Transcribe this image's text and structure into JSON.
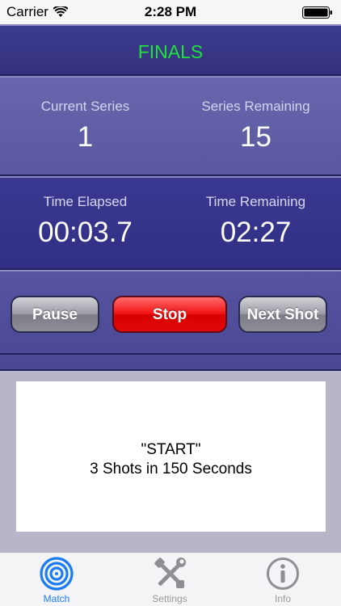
{
  "status_bar": {
    "carrier": "Carrier",
    "time": "2:28 PM"
  },
  "header": {
    "title": "FINALS",
    "title_color": "#1fe33a"
  },
  "series": {
    "current": {
      "label": "Current Series",
      "value": "1"
    },
    "remaining": {
      "label": "Series Remaining",
      "value": "15"
    }
  },
  "timer": {
    "elapsed": {
      "label": "Time Elapsed",
      "value": "00:03.7"
    },
    "remaining": {
      "label": "Time Remaining",
      "value": "02:27"
    }
  },
  "controls": {
    "pause_label": "Pause",
    "stop_label": "Stop",
    "next_label": "Next Shot"
  },
  "message": {
    "line1": "\"START\"",
    "line2": "3 Shots in 150 Seconds"
  },
  "tabs": [
    {
      "label": "Match",
      "icon": "target-icon",
      "active": true
    },
    {
      "label": "Settings",
      "icon": "tools-icon",
      "active": false
    },
    {
      "label": "Info",
      "icon": "info-icon",
      "active": false
    }
  ]
}
